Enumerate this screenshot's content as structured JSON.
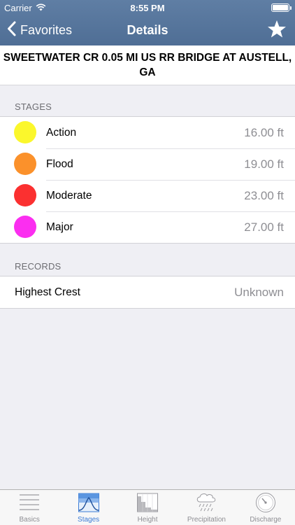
{
  "status_bar": {
    "carrier": "Carrier",
    "time": "8:55 PM",
    "battery_level": 1.0
  },
  "nav": {
    "back_label": "Favorites",
    "title": "Details",
    "back_icon": "chevron-left-icon",
    "action_icon": "star-icon"
  },
  "station": {
    "name": "SWEETWATER CR 0.05 MI US RR BRIDGE AT AUSTELL, GA"
  },
  "stages": {
    "header": "STAGES",
    "items": [
      {
        "label": "Action",
        "value": "16.00 ft",
        "color": "#fbf72c"
      },
      {
        "label": "Flood",
        "value": "19.00 ft",
        "color": "#fb912b"
      },
      {
        "label": "Moderate",
        "value": "23.00 ft",
        "color": "#fb3030"
      },
      {
        "label": "Major",
        "value": "27.00 ft",
        "color": "#fb2ef0"
      }
    ]
  },
  "records": {
    "header": "RECORDS",
    "items": [
      {
        "label": "Highest Crest",
        "value": "Unknown"
      }
    ]
  },
  "tabbar": {
    "active_color": "#3b7bd6",
    "inactive_color": "#8e8e93",
    "tabs": [
      {
        "label": "Basics",
        "icon": "list-lines-icon",
        "active": false
      },
      {
        "label": "Stages",
        "icon": "stage-graph-icon",
        "active": true
      },
      {
        "label": "Height",
        "icon": "height-chart-icon",
        "active": false
      },
      {
        "label": "Precipitation",
        "icon": "rain-cloud-icon",
        "active": false
      },
      {
        "label": "Discharge",
        "icon": "gauge-icon",
        "active": false
      }
    ]
  }
}
